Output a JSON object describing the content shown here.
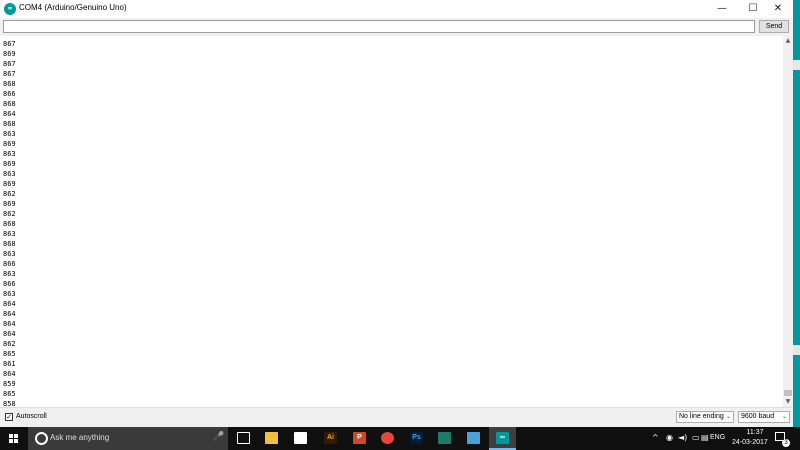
{
  "window": {
    "title": "COM4 (Arduino/Genuino Uno)",
    "icon": "arduino-icon",
    "controls": {
      "minimize": "—",
      "maximize": "☐",
      "close": "✕"
    }
  },
  "send_row": {
    "input_value": "",
    "send_label": "Send"
  },
  "output_lines": [
    "867",
    "869",
    "867",
    "867",
    "868",
    "866",
    "868",
    "864",
    "868",
    "863",
    "869",
    "863",
    "869",
    "863",
    "869",
    "862",
    "869",
    "862",
    "868",
    "863",
    "868",
    "863",
    "866",
    "863",
    "866",
    "863",
    "864",
    "864",
    "864",
    "864",
    "862",
    "865",
    "861",
    "864",
    "859",
    "865",
    "858"
  ],
  "scrollbar": {
    "up": "▲",
    "down": "▼"
  },
  "bottom_bar": {
    "autoscroll_label": "Autoscroll",
    "autoscroll_checked": true,
    "autoscroll_mark": "✓",
    "line_ending_value": "No line ending",
    "baud_value": "9600 baud",
    "chevron": "⌄"
  },
  "taskbar": {
    "search_placeholder": "Ask me anything",
    "mic_glyph": "🎤",
    "apps": [
      {
        "name": "task-view",
        "label": "",
        "color": "#101010",
        "fg": "#ffffff"
      },
      {
        "name": "file-explorer",
        "label": "",
        "color": "#f2c040",
        "fg": "#000000"
      },
      {
        "name": "store",
        "label": "",
        "color": "#ffffff",
        "fg": "#000000"
      },
      {
        "name": "illustrator",
        "label": "Ai",
        "color": "#2e1c05",
        "fg": "#ff9a00"
      },
      {
        "name": "powerpoint",
        "label": "P",
        "color": "#d24726",
        "fg": "#ffffff"
      },
      {
        "name": "chrome",
        "label": "",
        "color": "#e8453c",
        "fg": "#ffffff"
      },
      {
        "name": "photoshop",
        "label": "Ps",
        "color": "#001d34",
        "fg": "#31a8ff"
      },
      {
        "name": "app-arrow",
        "label": "",
        "color": "#1c7b6b",
        "fg": "#ffffff"
      },
      {
        "name": "app-blue",
        "label": "",
        "color": "#4aa3d8",
        "fg": "#ffffff"
      },
      {
        "name": "arduino",
        "label": "∞",
        "color": "#00979d",
        "fg": "#ffffff"
      }
    ],
    "tray": {
      "chevron": "^",
      "icons": [
        "◉",
        "◄)",
        "▭",
        "▤"
      ],
      "language": "ENG",
      "time": "11:37",
      "date": "24-03-2017",
      "notification_count": "3"
    }
  }
}
